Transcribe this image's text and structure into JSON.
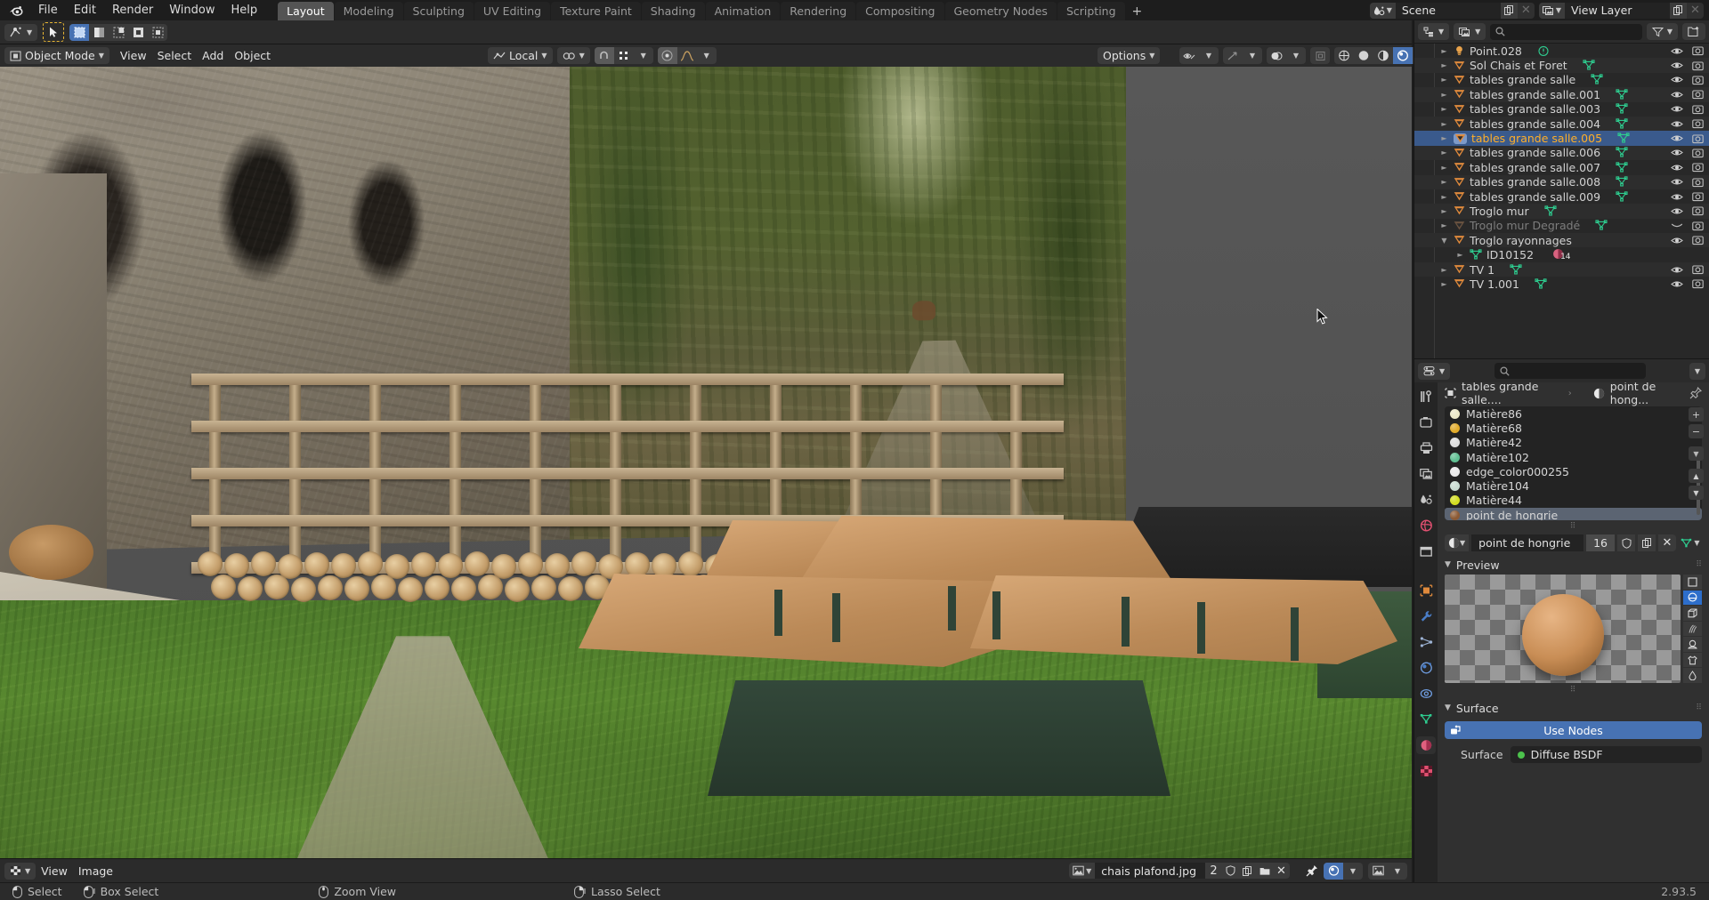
{
  "app": {
    "name": "Blender",
    "version": "2.93.5"
  },
  "topbar": {
    "menus": [
      "File",
      "Edit",
      "Render",
      "Window",
      "Help"
    ],
    "workspaces": [
      {
        "label": "Layout",
        "active": true
      },
      {
        "label": "Modeling",
        "active": false
      },
      {
        "label": "Sculpting",
        "active": false
      },
      {
        "label": "UV Editing",
        "active": false
      },
      {
        "label": "Texture Paint",
        "active": false
      },
      {
        "label": "Shading",
        "active": false
      },
      {
        "label": "Animation",
        "active": false
      },
      {
        "label": "Rendering",
        "active": false
      },
      {
        "label": "Compositing",
        "active": false
      },
      {
        "label": "Geometry Nodes",
        "active": false
      },
      {
        "label": "Scripting",
        "active": false
      }
    ],
    "add_workspace_label": "+",
    "scene_name": "Scene",
    "view_layer_name": "View Layer"
  },
  "viewport_header": {
    "mode": "Object Mode",
    "menus": [
      "View",
      "Select",
      "Add",
      "Object"
    ],
    "transform_orientation": "Local",
    "options_label": "Options"
  },
  "outliner": {
    "search_placeholder": "",
    "items": [
      {
        "name": "Point.028",
        "type": "light",
        "indent": 0,
        "selected": false,
        "disabled": false,
        "expand": "collapsed",
        "data_icon": "light-data"
      },
      {
        "name": "Sol Chais et Foret",
        "type": "mesh",
        "indent": 0,
        "selected": false,
        "disabled": false,
        "expand": "collapsed",
        "data_icon": "mesh-data"
      },
      {
        "name": "tables grande salle",
        "type": "mesh",
        "indent": 0,
        "selected": false,
        "disabled": false,
        "expand": "collapsed",
        "data_icon": "mesh-data"
      },
      {
        "name": "tables grande salle.001",
        "type": "mesh",
        "indent": 0,
        "selected": false,
        "disabled": false,
        "expand": "collapsed",
        "data_icon": "mesh-data"
      },
      {
        "name": "tables grande salle.003",
        "type": "mesh",
        "indent": 0,
        "selected": false,
        "disabled": false,
        "expand": "collapsed",
        "data_icon": "mesh-data"
      },
      {
        "name": "tables grande salle.004",
        "type": "mesh",
        "indent": 0,
        "selected": false,
        "disabled": false,
        "expand": "collapsed",
        "data_icon": "mesh-data"
      },
      {
        "name": "tables grande salle.005",
        "type": "mesh",
        "indent": 0,
        "selected": true,
        "disabled": false,
        "expand": "collapsed",
        "data_icon": "mesh-data"
      },
      {
        "name": "tables grande salle.006",
        "type": "mesh",
        "indent": 0,
        "selected": false,
        "disabled": false,
        "expand": "collapsed",
        "data_icon": "mesh-data"
      },
      {
        "name": "tables grande salle.007",
        "type": "mesh",
        "indent": 0,
        "selected": false,
        "disabled": false,
        "expand": "collapsed",
        "data_icon": "mesh-data"
      },
      {
        "name": "tables grande salle.008",
        "type": "mesh",
        "indent": 0,
        "selected": false,
        "disabled": false,
        "expand": "collapsed",
        "data_icon": "mesh-data"
      },
      {
        "name": "tables grande salle.009",
        "type": "mesh",
        "indent": 0,
        "selected": false,
        "disabled": false,
        "expand": "collapsed",
        "data_icon": "mesh-data"
      },
      {
        "name": "Troglo mur",
        "type": "mesh",
        "indent": 0,
        "selected": false,
        "disabled": false,
        "expand": "collapsed",
        "data_icon": "mesh-data"
      },
      {
        "name": "Troglo mur Degradé",
        "type": "mesh",
        "indent": 0,
        "selected": false,
        "disabled": true,
        "expand": "collapsed",
        "data_icon": "mesh-data"
      },
      {
        "name": "Troglo rayonnages",
        "type": "mesh",
        "indent": 0,
        "selected": false,
        "disabled": false,
        "expand": "expanded",
        "data_icon": "none"
      },
      {
        "name": "ID10152",
        "type": "mesh-data",
        "indent": 1,
        "selected": false,
        "disabled": false,
        "expand": "collapsed",
        "data_icon": "material-count",
        "badge": "14"
      },
      {
        "name": "TV 1",
        "type": "mesh",
        "indent": 0,
        "selected": false,
        "disabled": false,
        "expand": "collapsed",
        "data_icon": "mesh-data"
      },
      {
        "name": "TV 1.001",
        "type": "mesh",
        "indent": 0,
        "selected": false,
        "disabled": false,
        "expand": "collapsed",
        "data_icon": "mesh-data"
      }
    ]
  },
  "properties": {
    "breadcrumb_object": "tables grande salle....",
    "breadcrumb_material": "point de hong...",
    "material_slots": [
      {
        "name": "Matière86",
        "color": "#ece9c8",
        "selected": false
      },
      {
        "name": "Matière68",
        "color": "#e0aa2a",
        "selected": false
      },
      {
        "name": "Matière42",
        "color": "#dedede",
        "selected": false
      },
      {
        "name": "Matière102",
        "color": "#5fbf92",
        "selected": false
      },
      {
        "name": "edge_color000255",
        "color": "#e9e9e9",
        "selected": false
      },
      {
        "name": "Matière104",
        "color": "#c9dcd2",
        "selected": false
      },
      {
        "name": "Matière44",
        "color": "#d2dd20",
        "selected": false
      },
      {
        "name": "point de hongrie",
        "color": "#8c5a34",
        "selected": true
      }
    ],
    "list_buttons": [
      "+",
      "−",
      "v",
      "▲",
      "▼"
    ],
    "active_material": {
      "name": "point de hongrie",
      "users": "16"
    },
    "preview_panel_label": "Preview",
    "preview_types": [
      "flat",
      "sphere",
      "cube",
      "hair",
      "shaderball",
      "cloth",
      "fluid"
    ],
    "preview_active": "sphere",
    "surface_panel_label": "Surface",
    "use_nodes_label": "Use Nodes",
    "surface_label": "Surface",
    "surface_value": "Diffuse BSDF"
  },
  "image_editor": {
    "menus": [
      "View",
      "Image"
    ],
    "image_name": "chais plafond.jpg",
    "users": "2"
  },
  "statusbar": {
    "keymaps": [
      {
        "mouse": "left",
        "label": "Select"
      },
      {
        "mouse": "left-drag",
        "label": "Box Select"
      },
      {
        "mouse": "middle",
        "label": "Zoom View"
      },
      {
        "mouse": "right-drag",
        "label": "Lasso Select"
      }
    ],
    "version": "2.93.5"
  },
  "colors": {
    "accent_blue": "#4772b3",
    "select_orange": "#ffaf29",
    "outliner_mesh": "#e08a3c",
    "outliner_meshdata": "#2ecc8f",
    "header_bg": "#2b2b2b",
    "editor_bg": "#303030"
  }
}
